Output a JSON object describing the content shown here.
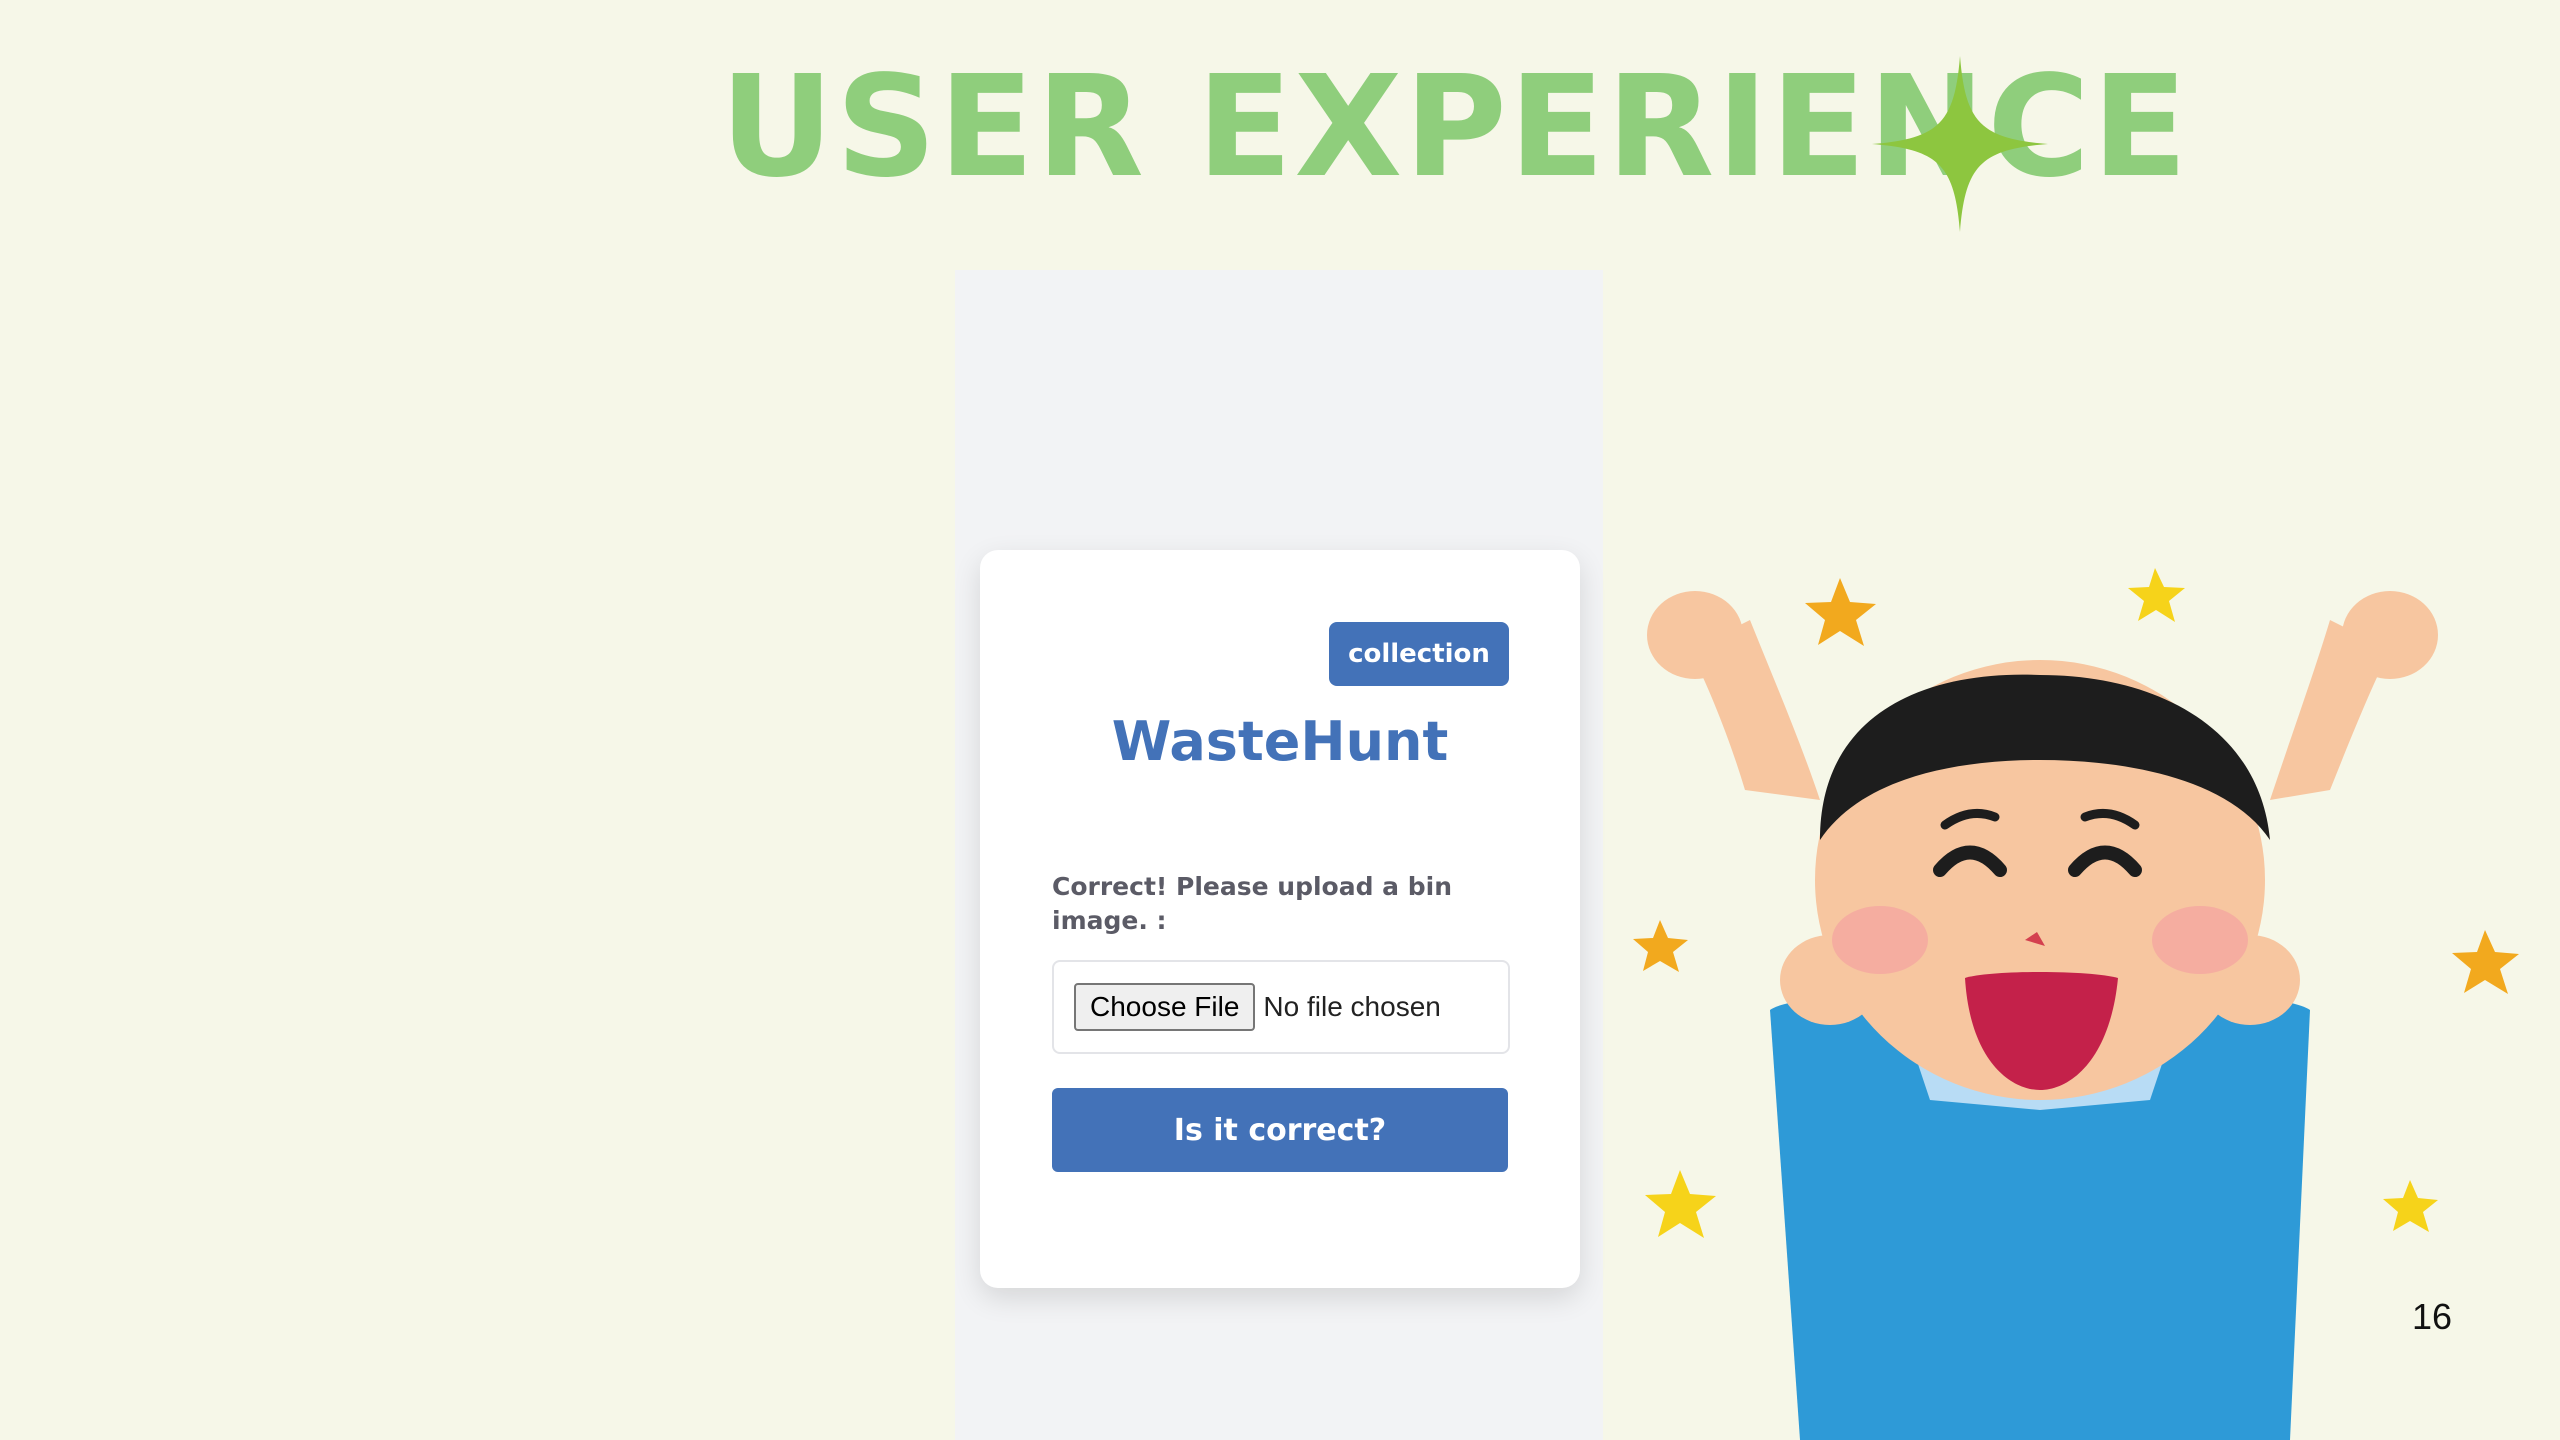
{
  "slide": {
    "title": "USER EXPERIENCE",
    "page_number": "16"
  },
  "app": {
    "collection_button": "collection",
    "title": "WasteHunt",
    "prompt": "Correct! Please upload a bin image. :",
    "file_input": {
      "button_label": "Choose File",
      "status": "No file chosen"
    },
    "submit_button": "Is it correct?"
  },
  "colors": {
    "background": "#f6f7e8",
    "title": "#8fce7c",
    "sparkle": "#8dc63f",
    "accent": "#4372b8",
    "card": "#ffffff",
    "phone_panel": "#f2f3f5"
  },
  "icons": [
    "sparkle-icon",
    "celebrating-kid-illustration"
  ]
}
